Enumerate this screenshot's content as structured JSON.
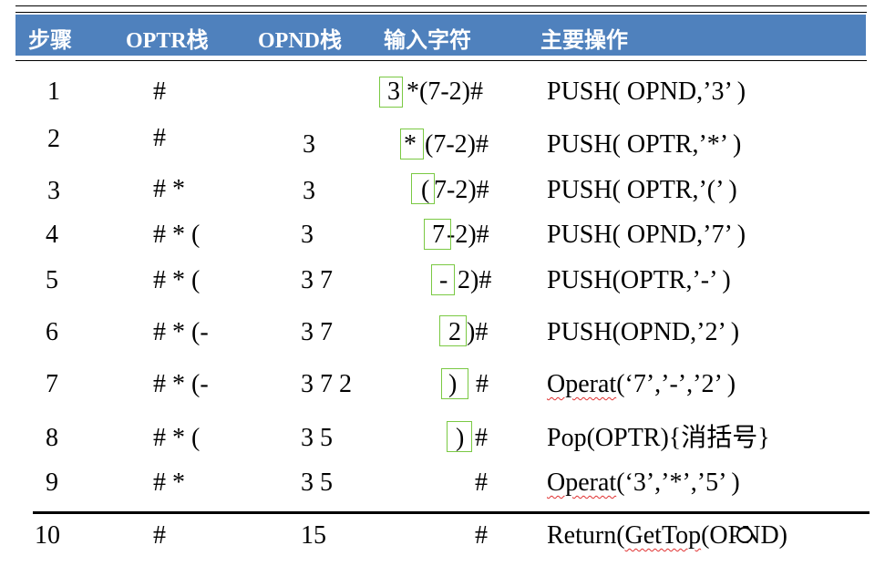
{
  "headers": {
    "step": "步骤",
    "optr": "OPTR栈",
    "opnd": "OPND栈",
    "input": "输入字符",
    "op": "主要操作"
  },
  "rows": [
    {
      "step": "1",
      "optr": "#",
      "opnd": "",
      "hl": "3",
      "rest": "*(7-2)#",
      "op": "PUSH( OPND,’3’ )"
    },
    {
      "step": "2",
      "optr": "#",
      "opnd": "3",
      "hl": "*",
      "rest": "(7-2)#",
      "op": "PUSH( OPTR,’*’ )"
    },
    {
      "step": "3",
      "optr": "# *",
      "opnd": "3",
      "hl": "(",
      "rest": "7-2)#",
      "op": "PUSH( OPTR,’(’ )"
    },
    {
      "step": "4",
      "optr": "# * (",
      "opnd": "3",
      "hl": "7",
      "rest": "-2)#",
      "op": "PUSH( OPND,’7’ )"
    },
    {
      "step": "5",
      "optr": "# * (",
      "opnd": "3  7",
      "hl": "-",
      "rest": "2)#",
      "op": "PUSH(OPTR,’-’ )"
    },
    {
      "step": "6",
      "optr": "# * (-",
      "opnd": "3  7",
      "hl": "2",
      "rest": ")#",
      "op": "PUSH(OPND,’2’ )"
    },
    {
      "step": "7",
      "optr": "# * (-",
      "opnd": "3  7  2",
      "hl": ")",
      "rest": "#",
      "op_word": "Operat",
      "op_rest": "(‘7’,’-’,’2’ )"
    },
    {
      "step": "8",
      "optr": "# * (",
      "opnd": "3  5",
      "hl": ")",
      "rest": "#",
      "op": "Pop(OPTR){消括号}"
    },
    {
      "step": "9",
      "optr": "# *",
      "opnd": "3  5",
      "hl": "",
      "rest": "#",
      "op_word": "Operat",
      "op_rest": "(‘3’,’*’,’5’ )"
    },
    {
      "step": "10",
      "optr": "#",
      "opnd": "15",
      "hl": "",
      "rest": "#",
      "op_pre": "Return(",
      "op_word": "GetTop",
      "op_rest": "(OPND)"
    }
  ],
  "colors": {
    "header_bg": "#4f81bd",
    "highlight": "#7ac943",
    "spellcheck": "#e03030"
  }
}
